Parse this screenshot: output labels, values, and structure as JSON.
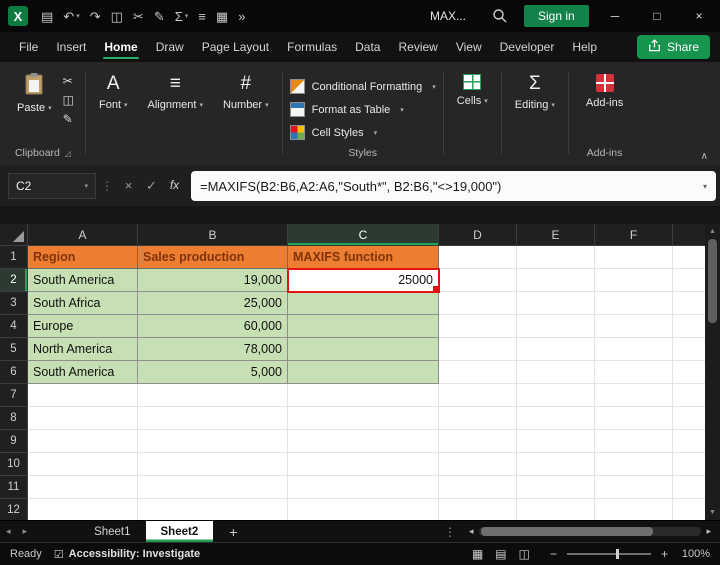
{
  "titlebar": {
    "title": "MAX...",
    "signin_label": "Sign in",
    "qat": [
      {
        "name": "save-icon",
        "glyph": "▤"
      },
      {
        "name": "undo-icon",
        "glyph": "↶",
        "chevron": true
      },
      {
        "name": "redo-icon",
        "glyph": "↷"
      },
      {
        "name": "clipboard-icon",
        "glyph": "◫"
      },
      {
        "name": "cut-icon",
        "glyph": "✂"
      },
      {
        "name": "format-painter-icon",
        "glyph": "✎"
      },
      {
        "name": "autosum-icon",
        "glyph": "Σ",
        "chevron": true
      },
      {
        "name": "sort-filter-icon",
        "glyph": "≡"
      },
      {
        "name": "chart-icon",
        "glyph": "▦"
      },
      {
        "name": "more-commands-icon",
        "glyph": "»"
      }
    ],
    "window_controls": [
      {
        "name": "minimize-button",
        "glyph": "─"
      },
      {
        "name": "maximize-button",
        "glyph": "□"
      },
      {
        "name": "close-button",
        "glyph": "×"
      }
    ]
  },
  "menu": {
    "tabs": [
      "File",
      "Insert",
      "Home",
      "Draw",
      "Page Layout",
      "Formulas",
      "Data",
      "Review",
      "View",
      "Developer",
      "Help"
    ],
    "active_tab": "Home",
    "share_label": "Share"
  },
  "ribbon": {
    "paste_label": "Paste",
    "clipboard_group_label": "Clipboard",
    "mini_icons": [
      {
        "name": "cut-icon",
        "glyph": "✂"
      },
      {
        "name": "copy-icon",
        "glyph": "◫"
      },
      {
        "name": "format-painter-icon",
        "glyph": "✎"
      }
    ],
    "collapsed_groups": [
      {
        "label": "Font",
        "icon": "font-icon",
        "glyph": "A"
      },
      {
        "label": "Alignment",
        "icon": "alignment-icon",
        "glyph": "≡"
      },
      {
        "label": "Number",
        "icon": "number-icon",
        "glyph": "#"
      }
    ],
    "styles_buttons": [
      {
        "label": "Conditional Formatting",
        "icon": "conditional-formatting-icon"
      },
      {
        "label": "Format as Table",
        "icon": "format-as-table-icon"
      },
      {
        "label": "Cell Styles",
        "icon": "cell-styles-icon"
      }
    ],
    "styles_group_label": "Styles",
    "cells_label": "Cells",
    "editing_label": "Editing",
    "addins_label": "Add-ins",
    "addins_group_label": "Add-ins"
  },
  "formula_bar": {
    "name_box": "C2",
    "buttons": [
      {
        "name": "cancel-icon",
        "glyph": "×"
      },
      {
        "name": "enter-icon",
        "glyph": "✓"
      },
      {
        "name": "insert-function-icon",
        "glyph": "fx"
      }
    ],
    "formula": "=MAXIFS(B2:B6,A2:A6,\"South*\", B2:B6,\"<>19,000\")"
  },
  "grid": {
    "col_headers": [
      "A",
      "B",
      "C",
      "D",
      "E",
      "F"
    ],
    "selected_cell": "C2",
    "selected_col": "C",
    "selected_row": 2,
    "rows": [
      {
        "n": "1",
        "cells": [
          "Region",
          "Sales production",
          "MAXIFS function",
          "",
          "",
          ""
        ]
      },
      {
        "n": "2",
        "cells": [
          "South America",
          "19,000",
          "25000",
          "",
          "",
          ""
        ]
      },
      {
        "n": "3",
        "cells": [
          "South Africa",
          "25,000",
          "",
          "",
          "",
          ""
        ]
      },
      {
        "n": "4",
        "cells": [
          "Europe",
          "60,000",
          "",
          "",
          "",
          ""
        ]
      },
      {
        "n": "5",
        "cells": [
          "North America",
          "78,000",
          "",
          "",
          "",
          ""
        ]
      },
      {
        "n": "6",
        "cells": [
          "South America",
          "5,000",
          "",
          "",
          "",
          ""
        ]
      },
      {
        "n": "7",
        "cells": [
          "",
          "",
          "",
          "",
          "",
          ""
        ]
      },
      {
        "n": "8",
        "cells": [
          "",
          "",
          "",
          "",
          "",
          ""
        ]
      },
      {
        "n": "9",
        "cells": [
          "",
          "",
          "",
          "",
          "",
          ""
        ]
      },
      {
        "n": "10",
        "cells": [
          "",
          "",
          "",
          "",
          "",
          ""
        ]
      },
      {
        "n": "11",
        "cells": [
          "",
          "",
          "",
          "",
          "",
          ""
        ]
      },
      {
        "n": "12",
        "cells": [
          "",
          "",
          "",
          "",
          "",
          ""
        ]
      }
    ]
  },
  "sheet_bar": {
    "tabs": [
      "Sheet1",
      "Sheet2"
    ],
    "active_tab": "Sheet2",
    "add_sheet_label": "+"
  },
  "status_bar": {
    "ready_label": "Ready",
    "accessibility_label": "Accessibility: Investigate",
    "accessibility_icon_glyph": "☑",
    "view_icons": [
      {
        "name": "normal-view-icon",
        "glyph": "▦"
      },
      {
        "name": "page-layout-view-icon",
        "glyph": "▤"
      },
      {
        "name": "page-break-preview-icon",
        "glyph": "◫"
      }
    ],
    "zoom_out_label": "−",
    "zoom_in_label": "+",
    "zoom_level": "100%"
  }
}
